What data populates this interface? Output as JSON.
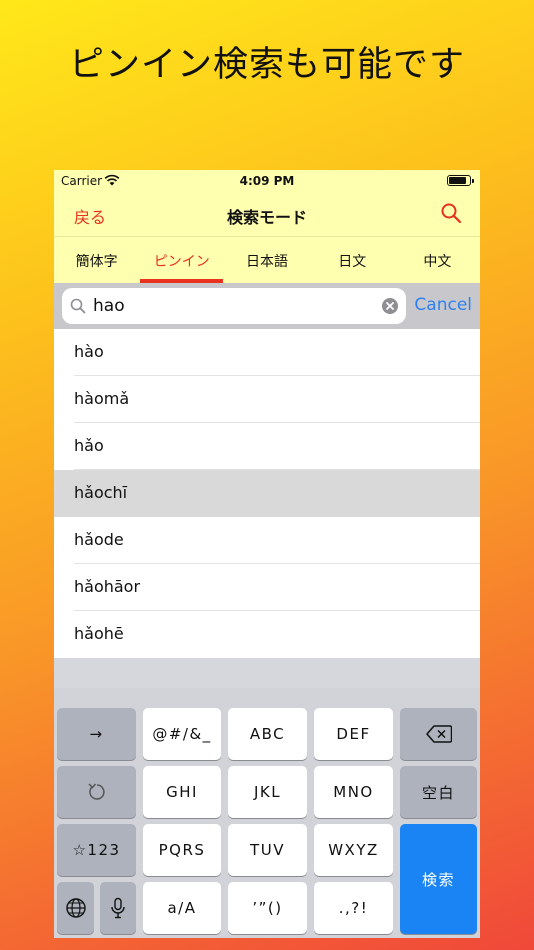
{
  "promo": {
    "title": "ピンイン検索も可能です"
  },
  "status_bar": {
    "carrier": "Carrier",
    "time": "4:09 PM",
    "battery_level": 0.85
  },
  "nav": {
    "back_label": "戻る",
    "title": "検索モード",
    "search_icon": "search-icon",
    "accent_color": "#e6321e"
  },
  "tabs": [
    {
      "label": "簡体字",
      "active": false
    },
    {
      "label": "ピンイン",
      "active": true
    },
    {
      "label": "日本語",
      "active": false
    },
    {
      "label": "日文",
      "active": false
    },
    {
      "label": "中文",
      "active": false
    }
  ],
  "search": {
    "value": "hao",
    "cancel_label": "Cancel",
    "clear_icon": "clear-circle-icon"
  },
  "results": [
    {
      "text": "hào",
      "selected": false
    },
    {
      "text": "hàomǎ",
      "selected": false
    },
    {
      "text": "hǎo",
      "selected": false
    },
    {
      "text": "hǎochī",
      "selected": true
    },
    {
      "text": "hǎode",
      "selected": false
    },
    {
      "text": "hǎohāor",
      "selected": false
    },
    {
      "text": "hǎohē",
      "selected": false
    }
  ],
  "keyboard": {
    "row1": {
      "arrow": "→",
      "k1": "@#/&_",
      "k2": "ABC",
      "k3": "DEF",
      "delete_icon": "backspace-icon"
    },
    "row2": {
      "undo_icon": "undo-icon",
      "k1": "GHI",
      "k2": "JKL",
      "k3": "MNO",
      "space": "空白"
    },
    "row3": {
      "mode": "☆123",
      "k1": "PQRS",
      "k2": "TUV",
      "k3": "WXYZ",
      "enter": "検索"
    },
    "row4": {
      "globe_icon": "globe-icon",
      "mic_icon": "microphone-icon",
      "k1": "a/A",
      "k2": "’”()",
      "k3": ".,?!"
    }
  }
}
